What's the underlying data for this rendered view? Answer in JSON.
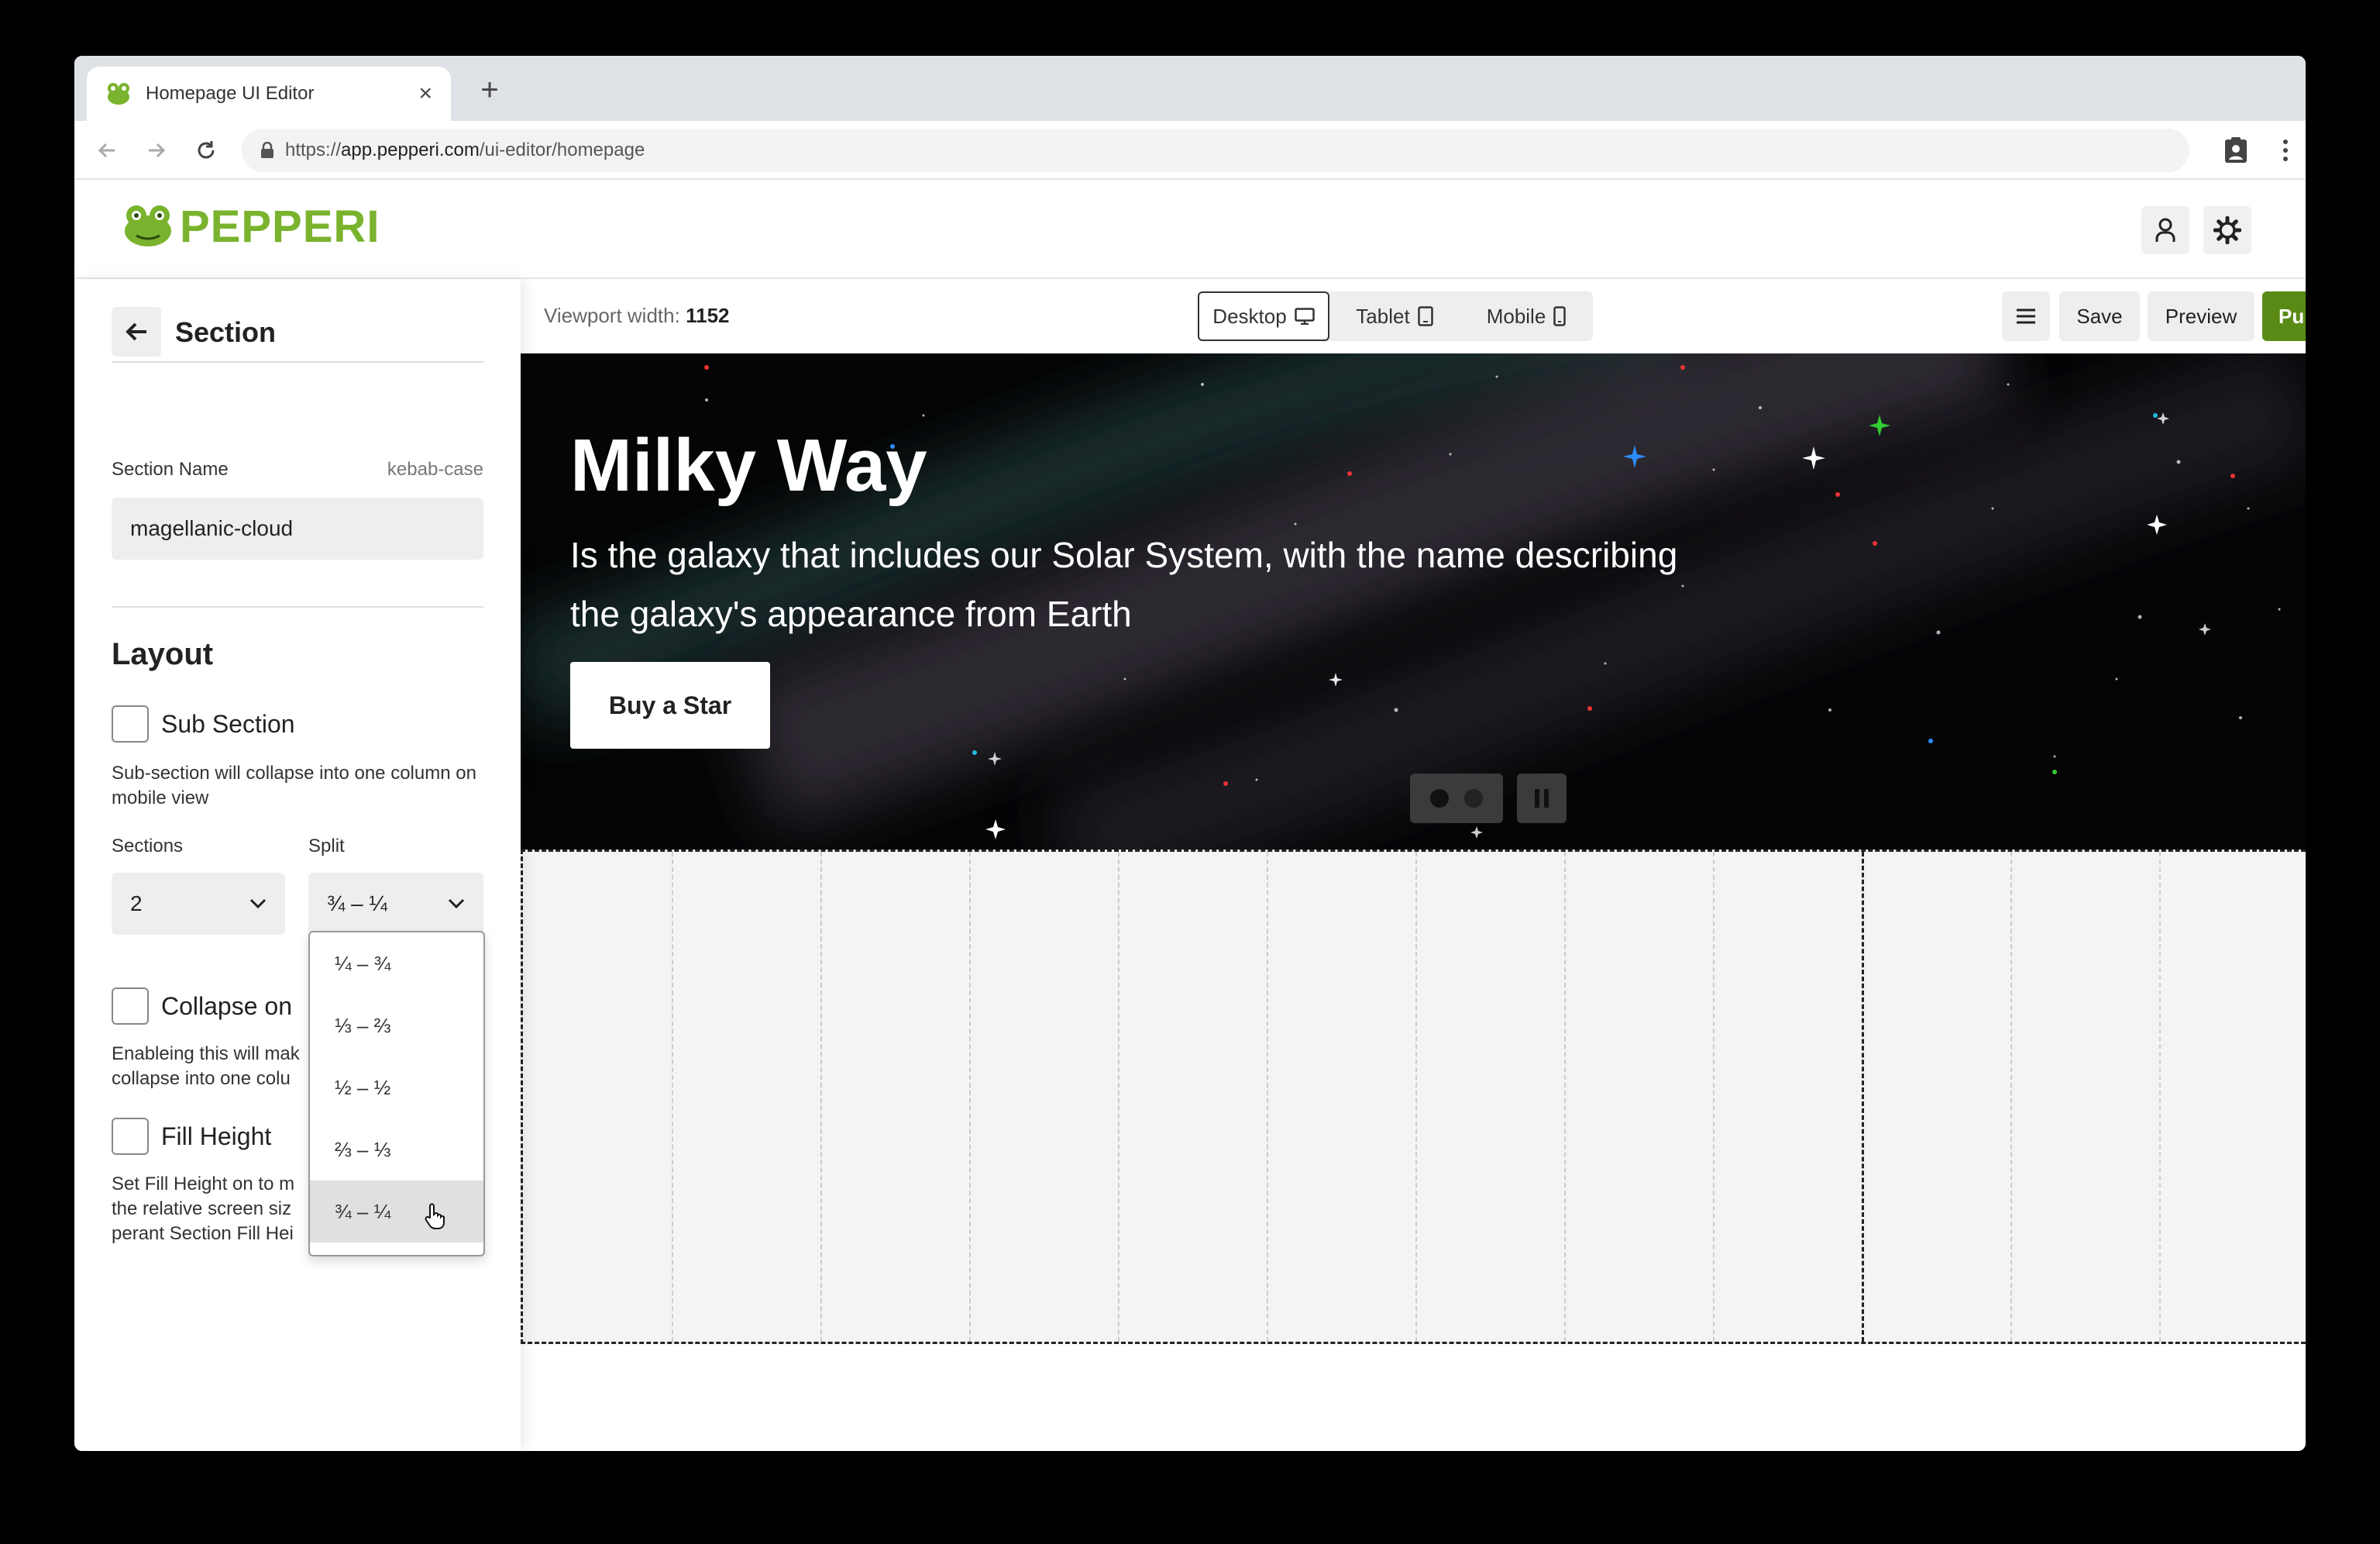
{
  "browser": {
    "tab_title": "Homepage UI Editor",
    "url_scheme": "https://",
    "url_host": "app.pepperi.com",
    "url_path": "/ui-editor/homepage"
  },
  "header": {
    "logo_text": "PEPPERI",
    "brand_color": "#7ab32e"
  },
  "panel": {
    "title": "Section",
    "section_name_label": "Section Name",
    "section_name_hint": "kebab-case",
    "section_name_value": "magellanic-cloud",
    "layout_heading": "Layout",
    "sub_section_label": "Sub Section",
    "sub_section_desc": "Sub-section will collapse into one column on mobile view",
    "sections_label": "Sections",
    "sections_value": "2",
    "split_label": "Split",
    "split_value": "¾ – ¼",
    "split_options": [
      "¼ – ¾",
      "⅓ – ⅔",
      "½ – ½",
      "⅔ – ⅓",
      "¾ – ¼"
    ],
    "collapse_label": "Collapse on",
    "collapse_desc": "Enableing this will mak collapse into one colu",
    "fill_height_label": "Fill Height",
    "fill_height_desc": "Set Fill Height on to m the relative screen siz perant Section Fill Hei"
  },
  "canvas_toolbar": {
    "viewport_label": "Viewport width:",
    "viewport_value": "1152",
    "devices": [
      "Desktop",
      "Tablet",
      "Mobile"
    ],
    "active_device": "Desktop",
    "save_label": "Save",
    "preview_label": "Preview",
    "publish_label": "Publish",
    "publish_color": "#5a8a16"
  },
  "hero": {
    "title": "Milky Way",
    "subtitle": "Is the galaxy that includes our Solar System, with the name describing the galaxy's appearance from Earth",
    "button_label": "Buy a Star"
  }
}
